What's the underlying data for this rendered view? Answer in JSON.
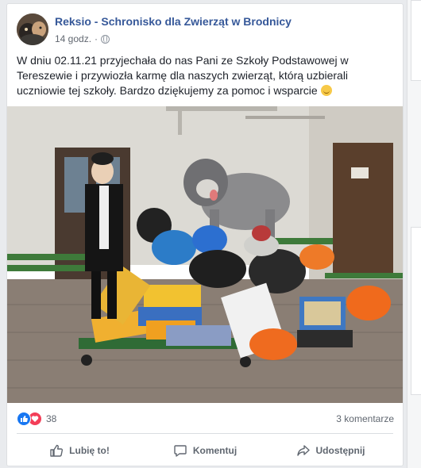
{
  "post": {
    "page_name": "Reksio - Schronisko dla Zwierząt w Brodnicy",
    "time": "14 godz.",
    "separator": "·",
    "privacy_icon": "globe-icon",
    "text": "W dniu 02.11.21 przyjechała do nas Pani ze Szkoły Podstawowej w Tereszewie i przywiozła karmę dla naszych zwierząt, którą uzbierali uczniowie tej szkoły. Bardzo dziękujemy za pomoc i wsparcie",
    "text_emoji": "smile-emoji-icon",
    "photo_icon": "post-photo"
  },
  "stats": {
    "reaction_icons": [
      "like-reaction-icon",
      "love-reaction-icon"
    ],
    "reaction_count": "38",
    "comments": "3 komentarze"
  },
  "actions": {
    "like": "Lubię to!",
    "comment": "Komentuj",
    "share": "Udostępnij"
  },
  "colors": {
    "link": "#365899",
    "like_blue": "#1877f2",
    "love_red": "#f33e58",
    "muted": "#606770"
  }
}
